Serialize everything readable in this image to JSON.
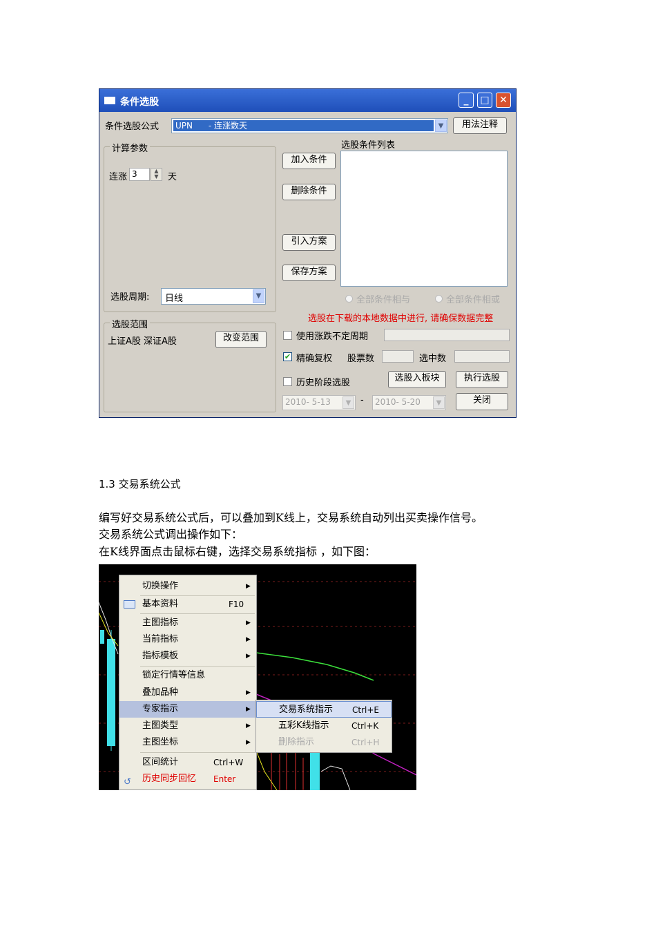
{
  "window": {
    "title": "条件选股",
    "formula_label": "条件选股公式",
    "formula_value": "UPN      - 连涨数天",
    "usage_button": "用法注释",
    "params_group": "计算参数",
    "param_label": "连涨",
    "param_value": "3",
    "param_unit": "天",
    "list_title": "选股条件列表",
    "add_button": "加入条件",
    "delete_button": "删除条件",
    "import_button": "引入方案",
    "save_button": "保存方案",
    "period_label": "选股周期:",
    "period_value": "日线",
    "radio_and": "全部条件相与",
    "radio_or": "全部条件相或",
    "warning": "选股在下载的本地数据中进行, 请确保数据完整",
    "range_group": "选股范围",
    "range_value": "上证A股 深证A股",
    "change_range_button": "改变范围",
    "check_period": "使用涨跌不定周期",
    "check_adjust": "精确复权",
    "stock_count_label": "股票数",
    "selected_label": "选中数",
    "check_history": "历史阶段选股",
    "to_block_button": "选股入板块",
    "execute_button": "执行选股",
    "date_from": "2010- 5-13",
    "date_sep": "-",
    "date_to": "2010- 5-20",
    "close_button": "关闭"
  },
  "document": {
    "section_heading": "1.3 交易系统公式",
    "para1": "编写好交易系统公式后，可以叠加到K线上，交易系统自动列出买卖操作信号。",
    "para2": "交易系统公式调出操作如下：",
    "para3": "在K线界面点击鼠标右键，选择交易系统指标     ，如下图："
  },
  "context_menu": {
    "items": [
      {
        "label": "切换操作",
        "shortcut": "",
        "submenu": true
      },
      {
        "label": "基本资料",
        "shortcut": "F10",
        "submenu": false
      },
      {
        "label": "主图指标",
        "shortcut": "",
        "submenu": true
      },
      {
        "label": "当前指标",
        "shortcut": "",
        "submenu": true
      },
      {
        "label": "指标模板",
        "shortcut": "",
        "submenu": true
      },
      {
        "label": "锁定行情等信息",
        "shortcut": "",
        "submenu": false
      },
      {
        "label": "叠加品种",
        "shortcut": "",
        "submenu": true
      },
      {
        "label": "专家指示",
        "shortcut": "",
        "submenu": true
      },
      {
        "label": "主图类型",
        "shortcut": "",
        "submenu": true
      },
      {
        "label": "主图坐标",
        "shortcut": "",
        "submenu": true
      },
      {
        "label": "区间统计",
        "shortcut": "Ctrl+W",
        "submenu": false
      },
      {
        "label": "历史同步回忆",
        "shortcut": "Enter",
        "submenu": false
      }
    ],
    "sub_items": [
      {
        "label": "交易系统指示",
        "shortcut": "Ctrl+E"
      },
      {
        "label": "五彩K线指示",
        "shortcut": "Ctrl+K"
      },
      {
        "label": "删除指示",
        "shortcut": "Ctrl+H"
      }
    ]
  }
}
